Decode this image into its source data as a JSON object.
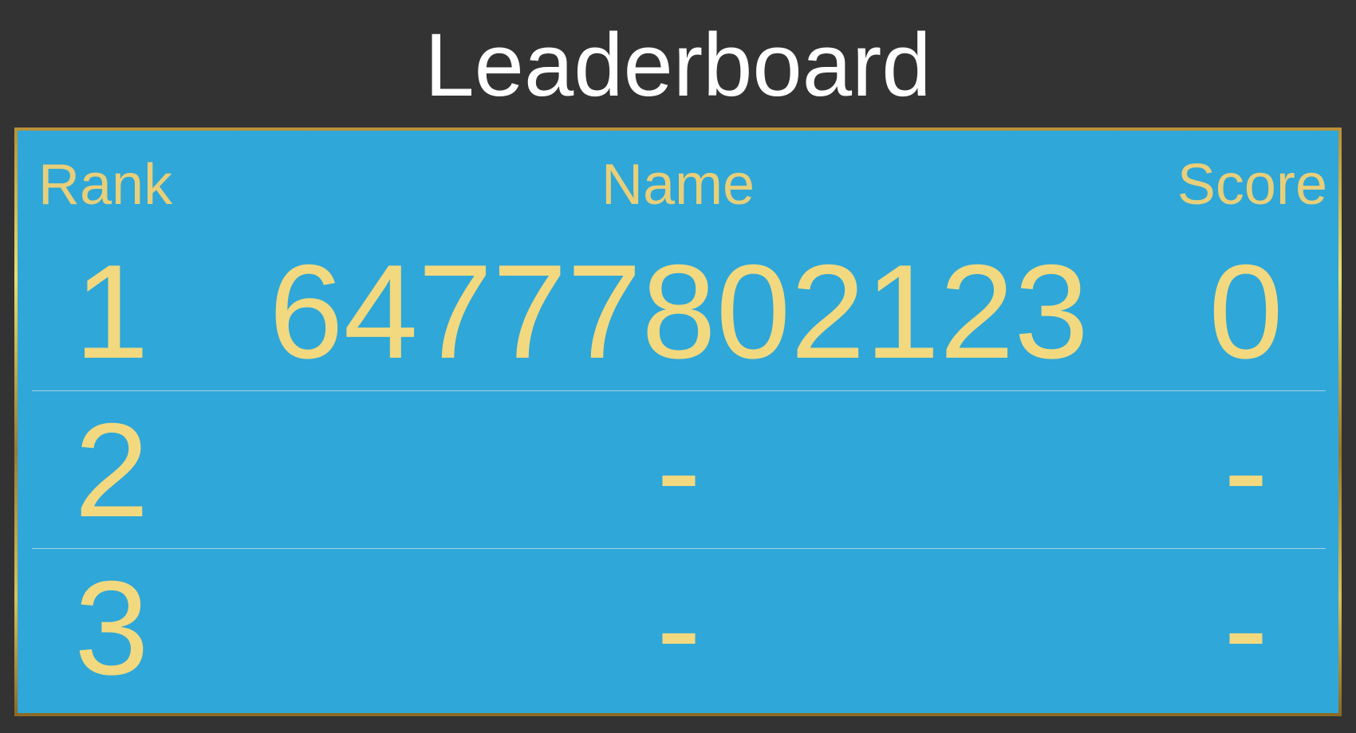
{
  "title": "Leaderboard",
  "columns": {
    "rank": "Rank",
    "name": "Name",
    "score": "Score"
  },
  "rows": [
    {
      "rank": "1",
      "name": "64777802123",
      "score": "0"
    },
    {
      "rank": "2",
      "name": "-",
      "score": "-"
    },
    {
      "rank": "3",
      "name": "-",
      "score": "-"
    }
  ],
  "colors": {
    "background": "#333333",
    "board": "#2fa7d8",
    "header_text": "#e8cf7a",
    "cell_text": "#f2d97f",
    "title_text": "#ffffff",
    "frame_gold": "#b8913a"
  }
}
